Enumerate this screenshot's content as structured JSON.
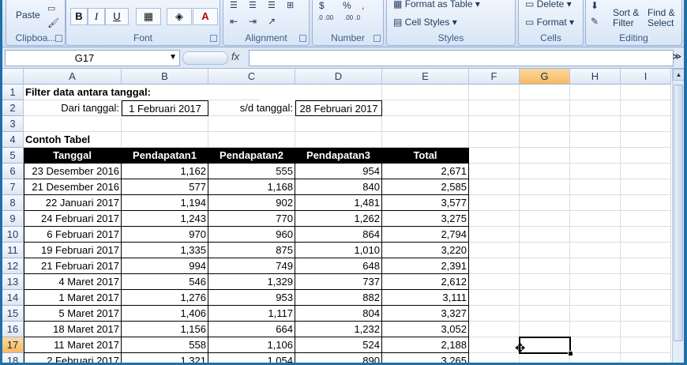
{
  "ribbon": {
    "clipboard": {
      "label": "Clipboa...",
      "paste": "Paste"
    },
    "font": {
      "label": "Font",
      "bold": "B",
      "italic": "I",
      "underline": "U",
      "font_color": "A"
    },
    "alignment": {
      "label": "Alignment"
    },
    "number": {
      "label": "Number",
      "currency": "$",
      "percent": "%",
      "comma": ",",
      "inc_dec": ".0 .00",
      "dec_dec": ".00 .0"
    },
    "styles": {
      "label": "Styles",
      "format_table": "Format as Table",
      "cell_styles": "Cell Styles"
    },
    "cells": {
      "label": "Cells",
      "delete": "Delete",
      "format": "Format"
    },
    "editing": {
      "label": "Editing",
      "sort_filter": "Sort &\nFilter",
      "find_select": "Find &\nSelect"
    }
  },
  "formula_bar": {
    "name_box": "G17",
    "fx": "fx",
    "value": ""
  },
  "columns": [
    "A",
    "B",
    "C",
    "D",
    "E",
    "F",
    "G",
    "H",
    "I"
  ],
  "selected_column": "G",
  "selected_row": "17",
  "rows": [
    "1",
    "2",
    "3",
    "4",
    "5",
    "6",
    "7",
    "8",
    "9",
    "10",
    "11",
    "12",
    "13",
    "14",
    "15",
    "16",
    "17",
    "18"
  ],
  "sheet": {
    "a1": "Filter data antara tanggal:",
    "a2": "Dari tanggal:",
    "b2": "1 Februari 2017",
    "c2": "s/d tanggal:",
    "d2": "28 Februari 2017",
    "a4": "Contoh Tabel",
    "headers": [
      "Tanggal",
      "Pendapatan1",
      "Pendapatan2",
      "Pendapatan3",
      "Total"
    ],
    "data": [
      [
        "23 Desember 2016",
        "1,162",
        "555",
        "954",
        "2,671"
      ],
      [
        "21 Desember 2016",
        "577",
        "1,168",
        "840",
        "2,585"
      ],
      [
        "22 Januari 2017",
        "1,194",
        "902",
        "1,481",
        "3,577"
      ],
      [
        "24 Februari 2017",
        "1,243",
        "770",
        "1,262",
        "3,275"
      ],
      [
        "6 Februari 2017",
        "970",
        "960",
        "864",
        "2,794"
      ],
      [
        "19 Februari 2017",
        "1,335",
        "875",
        "1,010",
        "3,220"
      ],
      [
        "21 Februari 2017",
        "994",
        "749",
        "648",
        "2,391"
      ],
      [
        "4 Maret 2017",
        "546",
        "1,329",
        "737",
        "2,612"
      ],
      [
        "1 Maret 2017",
        "1,276",
        "953",
        "882",
        "3,111"
      ],
      [
        "5 Maret 2017",
        "1,406",
        "1,117",
        "804",
        "3,327"
      ],
      [
        "18 Maret 2017",
        "1,156",
        "664",
        "1,232",
        "3,052"
      ],
      [
        "11 Maret 2017",
        "558",
        "1,106",
        "524",
        "2,188"
      ],
      [
        "2 Februari 2017",
        "1,321",
        "1,054",
        "890",
        "3,265"
      ]
    ]
  }
}
